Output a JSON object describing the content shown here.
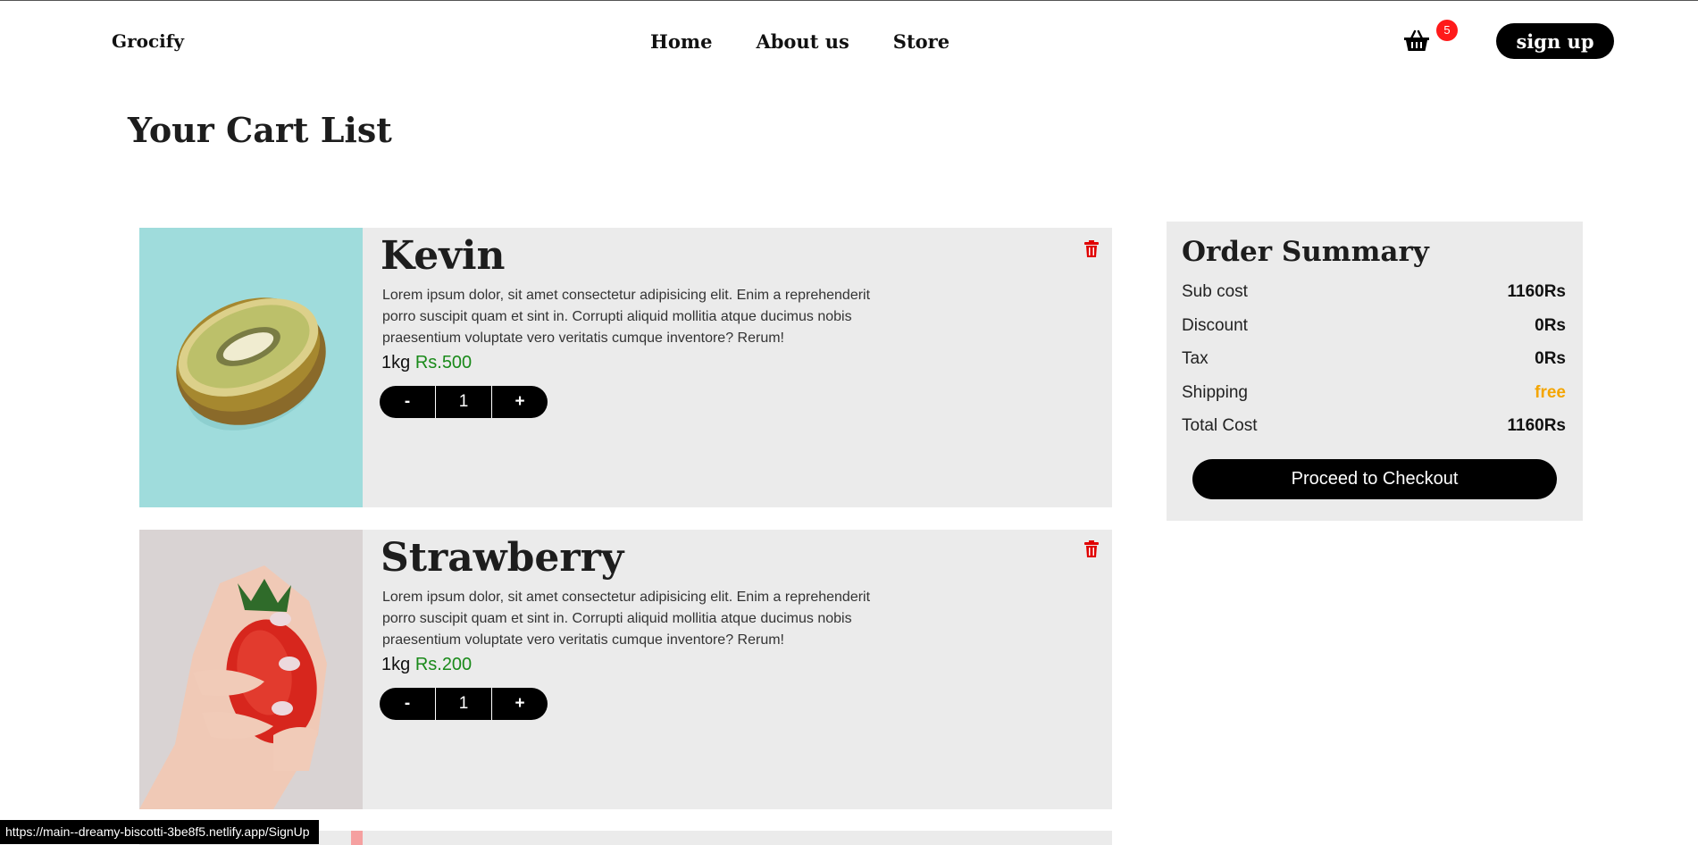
{
  "nav": {
    "brand": "Grocify",
    "links": [
      "Home",
      "About us",
      "Store"
    ],
    "cart_count": "5",
    "signup_label": "sign up"
  },
  "page_title": "Your Cart List",
  "items": [
    {
      "name": "Kevin",
      "description": "Lorem ipsum dolor, sit amet consectetur adipisicing elit. Enim a reprehenderit porro suscipit quam et sint in. Corrupti aliquid mollitia atque ducimus nobis praesentium voluptate vero veritatis cumque inventore? Rerum!",
      "unit": "1kg",
      "price": "Rs.500",
      "qty_minus": "-",
      "qty": "1",
      "qty_plus": "+"
    },
    {
      "name": "Strawberry",
      "description": "Lorem ipsum dolor, sit amet consectetur adipisicing elit. Enim a reprehenderit porro suscipit quam et sint in. Corrupti aliquid mollitia atque ducimus nobis praesentium voluptate vero veritatis cumque inventore? Rerum!",
      "unit": "1kg",
      "price": "Rs.200",
      "qty_minus": "-",
      "qty": "1",
      "qty_plus": "+"
    }
  ],
  "summary": {
    "title": "Order Summary",
    "rows": [
      {
        "label": "Sub cost",
        "value": "1160Rs"
      },
      {
        "label": "Discount",
        "value": "0Rs"
      },
      {
        "label": "Tax",
        "value": "0Rs"
      },
      {
        "label": "Shipping",
        "value": "free"
      },
      {
        "label": "Total Cost",
        "value": "1160Rs"
      }
    ],
    "checkout_label": "Proceed to Checkout"
  },
  "status_url": "https://main--dreamy-biscotti-3be8f5.netlify.app/SignUp",
  "colors": {
    "accent_price": "#1a8a1a",
    "shipping_free": "#f4a500",
    "badge": "#ff1a1a",
    "delete_icon": "#e00000"
  }
}
